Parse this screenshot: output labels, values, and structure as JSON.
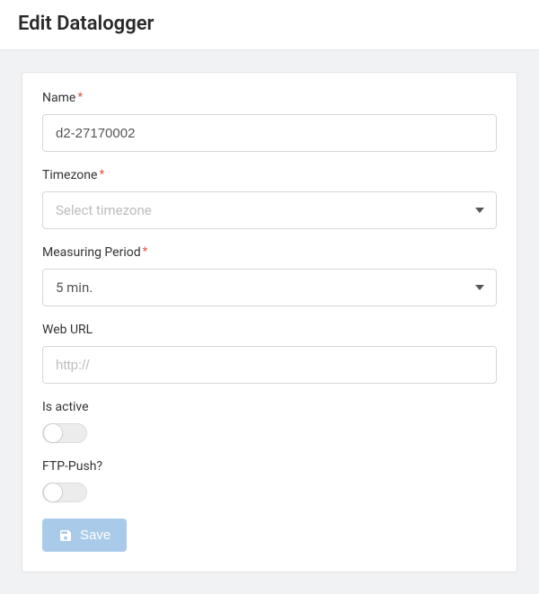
{
  "header": {
    "title": "Edit Datalogger"
  },
  "form": {
    "name": {
      "label": "Name",
      "required": true,
      "value": "d2-27170002"
    },
    "timezone": {
      "label": "Timezone",
      "required": true,
      "placeholder": "Select timezone",
      "value": ""
    },
    "measuring_period": {
      "label": "Measuring Period",
      "required": true,
      "value": "5 min."
    },
    "web_url": {
      "label": "Web URL",
      "required": false,
      "placeholder": "http://",
      "value": ""
    },
    "is_active": {
      "label": "Is active",
      "value": false
    },
    "ftp_push": {
      "label": "FTP-Push?",
      "value": false
    },
    "save_label": "Save"
  }
}
